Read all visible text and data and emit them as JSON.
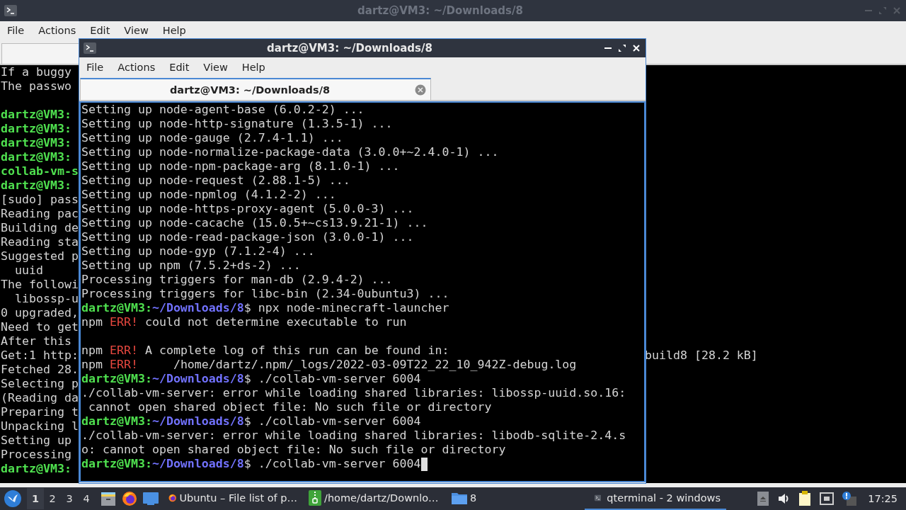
{
  "back_window": {
    "title": "dartz@VM3: ~/Downloads/8",
    "active": false,
    "menu": [
      "File",
      "Actions",
      "Edit",
      "View",
      "Help"
    ],
    "lines": [
      {
        "kind": "output",
        "text": "If a buggy"
      },
      {
        "kind": "output",
        "text": "The passwo"
      },
      {
        "kind": "blank"
      },
      {
        "kind": "prompt",
        "user": "dartz@VM3:"
      },
      {
        "kind": "prompt",
        "user": "dartz@VM3:"
      },
      {
        "kind": "prompt",
        "user": "dartz@VM3:"
      },
      {
        "kind": "prompt",
        "user": "dartz@VM3:"
      },
      {
        "kind": "prompt",
        "user": "collab-vm-s"
      },
      {
        "kind": "prompt",
        "user": "dartz@VM3:"
      },
      {
        "kind": "output",
        "text": "[sudo] pass"
      },
      {
        "kind": "output",
        "text": "Reading pac"
      },
      {
        "kind": "output",
        "text": "Building de"
      },
      {
        "kind": "output",
        "text": "Reading sta"
      },
      {
        "kind": "output",
        "text": "Suggested p"
      },
      {
        "kind": "output",
        "text": "  uuid"
      },
      {
        "kind": "output",
        "text": "The followi"
      },
      {
        "kind": "output",
        "text": "  libossp-u"
      },
      {
        "kind": "output",
        "text": "0 upgraded,"
      },
      {
        "kind": "output",
        "text": "Need to get"
      },
      {
        "kind": "output",
        "text": "After this"
      },
      {
        "kind": "output",
        "text": "Get:1 http:",
        "tail": "build8 [28.2 kB]"
      },
      {
        "kind": "output",
        "text": "Fetched 28."
      },
      {
        "kind": "output",
        "text": "Selecting p"
      },
      {
        "kind": "output",
        "text": "(Reading da"
      },
      {
        "kind": "output",
        "text": "Preparing t"
      },
      {
        "kind": "output",
        "text": "Unpacking l"
      },
      {
        "kind": "output",
        "text": "Setting up"
      },
      {
        "kind": "output",
        "text": "Processing"
      },
      {
        "kind": "prompt",
        "user": "dartz@VM3:"
      }
    ]
  },
  "front_window": {
    "title": "dartz@VM3: ~/Downloads/8",
    "active": true,
    "menu": [
      "File",
      "Actions",
      "Edit",
      "View",
      "Help"
    ],
    "tabs": [
      {
        "label": "dartz@VM3: ~/Downloads/8",
        "selected": true
      }
    ],
    "lines": [
      {
        "kind": "output",
        "text": "Setting up node-agent-base (6.0.2-2) ..."
      },
      {
        "kind": "output",
        "text": "Setting up node-http-signature (1.3.5-1) ..."
      },
      {
        "kind": "output",
        "text": "Setting up node-gauge (2.7.4-1.1) ..."
      },
      {
        "kind": "output",
        "text": "Setting up node-normalize-package-data (3.0.0+~2.4.0-1) ..."
      },
      {
        "kind": "output",
        "text": "Setting up node-npm-package-arg (8.1.0-1) ..."
      },
      {
        "kind": "output",
        "text": "Setting up node-request (2.88.1-5) ..."
      },
      {
        "kind": "output",
        "text": "Setting up node-npmlog (4.1.2-2) ..."
      },
      {
        "kind": "output",
        "text": "Setting up node-https-proxy-agent (5.0.0-3) ..."
      },
      {
        "kind": "output",
        "text": "Setting up node-cacache (15.0.5+~cs13.9.21-1) ..."
      },
      {
        "kind": "output",
        "text": "Setting up node-read-package-json (3.0.0-1) ..."
      },
      {
        "kind": "output",
        "text": "Setting up node-gyp (7.1.2-4) ..."
      },
      {
        "kind": "output",
        "text": "Setting up npm (7.5.2+ds-2) ..."
      },
      {
        "kind": "output",
        "text": "Processing triggers for man-db (2.9.4-2) ..."
      },
      {
        "kind": "output",
        "text": "Processing triggers for libc-bin (2.34-0ubuntu3) ..."
      },
      {
        "kind": "prompt",
        "user": "dartz@VM3:",
        "path": "~/Downloads/8",
        "command": "$ npx node-minecraft-launcher",
        "cursor": false
      },
      {
        "kind": "npm_error",
        "prefix": "npm",
        "tag": "ERR!",
        "text": "could not determine executable to run",
        "indent": false
      },
      {
        "kind": "blank"
      },
      {
        "kind": "npm_error",
        "prefix": "npm",
        "tag": "ERR!",
        "text": "A complete log of this run can be found in:",
        "indent": false
      },
      {
        "kind": "npm_error",
        "prefix": "npm",
        "tag": "ERR!",
        "text": "/home/dartz/.npm/_logs/2022-03-09T22_22_10_942Z-debug.log",
        "indent": true
      },
      {
        "kind": "prompt",
        "user": "dartz@VM3:",
        "path": "~/Downloads/8",
        "command": "$ ./collab-vm-server 6004",
        "cursor": false
      },
      {
        "kind": "output",
        "text": "./collab-vm-server: error while loading shared libraries: libossp-uuid.so.16:"
      },
      {
        "kind": "output",
        "text": " cannot open shared object file: No such file or directory"
      },
      {
        "kind": "prompt",
        "user": "dartz@VM3:",
        "path": "~/Downloads/8",
        "command": "$ ./collab-vm-server 6004",
        "cursor": false
      },
      {
        "kind": "output",
        "text": "./collab-vm-server: error while loading shared libraries: libodb-sqlite-2.4.s"
      },
      {
        "kind": "output",
        "text": "o: cannot open shared object file: No such file or directory"
      },
      {
        "kind": "prompt",
        "user": "dartz@VM3:",
        "path": "~/Downloads/8",
        "command": "$ ./collab-vm-server 6004",
        "cursor": true
      }
    ]
  },
  "taskbar": {
    "workspaces": [
      {
        "label": "1",
        "selected": true
      },
      {
        "label": "2",
        "selected": false
      },
      {
        "label": "3",
        "selected": false
      },
      {
        "label": "4",
        "selected": false
      }
    ],
    "launchers": [
      {
        "kind": "files"
      },
      {
        "kind": "browser"
      },
      {
        "kind": "desktop"
      }
    ],
    "tasks": [
      {
        "kind": "browser",
        "label": "Ubuntu – File list of p…",
        "selected": false
      },
      {
        "kind": "archive",
        "label": "/home/dartz/Downlo…",
        "selected": false
      },
      {
        "kind": "folder",
        "label": "8",
        "selected": false
      },
      {
        "kind": "terminal",
        "label": "qterminal - 2 windows",
        "selected": true
      }
    ],
    "clock": "17:25"
  }
}
